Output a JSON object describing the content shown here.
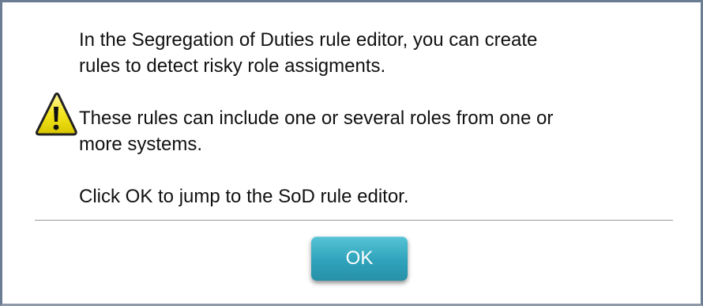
{
  "dialog": {
    "icon": "warning-icon",
    "message": {
      "line1": "In the Segregation of Duties rule editor, you can create",
      "line2": "rules to detect risky role assigments.",
      "line3": "These rules can include one or several roles from one or",
      "line4": "more systems.",
      "line5": "Click OK to jump to the SoD rule editor."
    },
    "ok_label": "OK"
  },
  "colors": {
    "warning_fill": "#f2e418",
    "button_accent": "#2fa3bb",
    "border": "#6b7d93"
  }
}
